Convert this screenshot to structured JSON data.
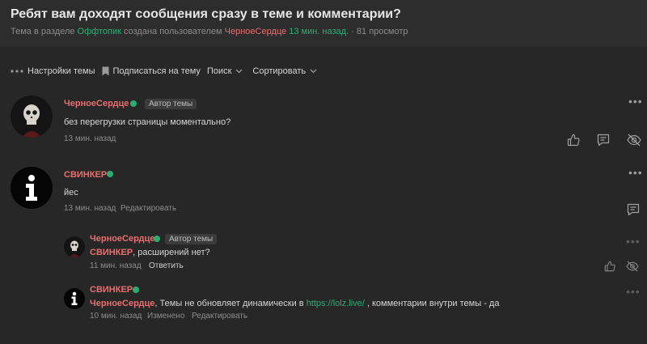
{
  "thread": {
    "title": "Ребят вам доходят сообщения сразу в теме и комментарии?",
    "meta_prefix": "Тема в разделе",
    "section": "Оффтопик",
    "meta_created": "создана пользователем",
    "author": "ЧерноеСердце",
    "created_ago": "13 мин. назад.",
    "views": "· 81 просмотр"
  },
  "toolbar": {
    "settings_label": "Настройки темы",
    "subscribe_label": "Подписаться на тему",
    "search_label": "Поиск",
    "sort_label": "Сортировать"
  },
  "posts": [
    {
      "username": "ЧерноеСердце",
      "badge": "Автор темы",
      "text": "без перегрузки страницы моментально?",
      "time": "13 мин. назад"
    },
    {
      "username": "СВИНКЕР",
      "text": "йес",
      "time": "13 мин. назад",
      "edit_label": "Редактировать"
    }
  ],
  "comments": [
    {
      "username": "ЧерноеСердце",
      "badge": "Автор темы",
      "mention": "СВИНКЕР",
      "text": ", расширений нет?",
      "time": "11 мин. назад",
      "reply_label": "Ответить"
    },
    {
      "username": "СВИНКЕР",
      "mention": "ЧерноеСердце",
      "text_before": ", Темы не обновляет динамически в ",
      "link": "https://lolz.live/",
      "text_after": " , комментарии внутри темы - да",
      "time": "10 мин. назад",
      "edited_label": "Изменено",
      "edit_label": "Редактировать"
    }
  ],
  "colors": {
    "accent_green": "#2bad72",
    "username_red": "#e76f6f",
    "background": "#272727"
  }
}
